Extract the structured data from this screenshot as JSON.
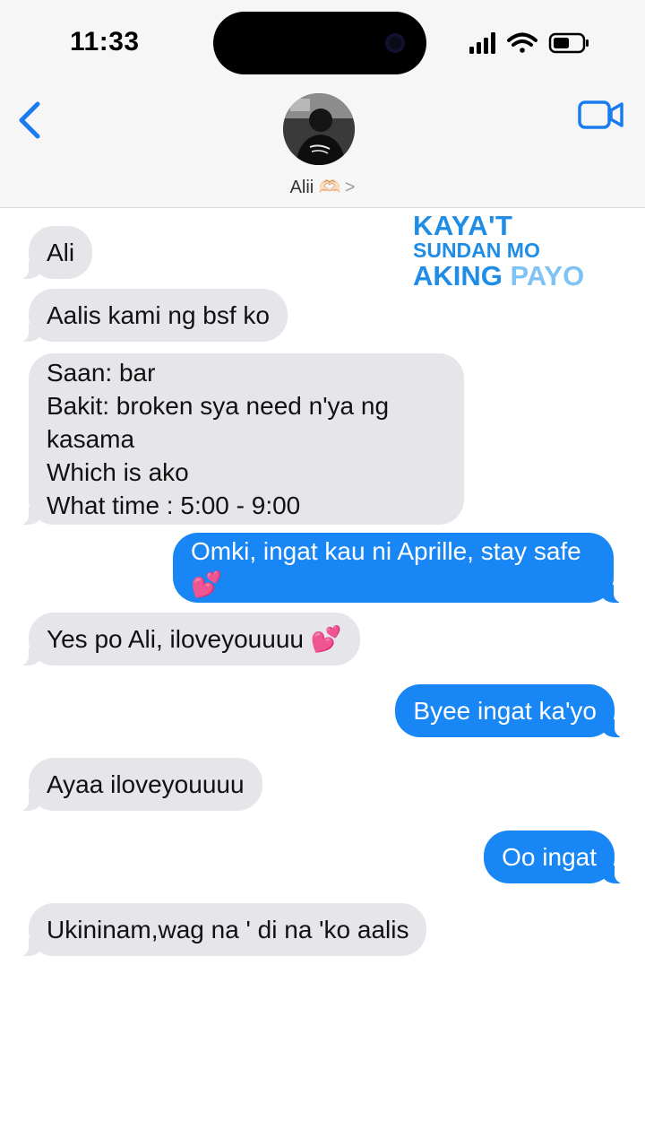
{
  "status_bar": {
    "time": "11:33"
  },
  "contact": {
    "name": "Alii 🫶🏻",
    "chevron": ">"
  },
  "overlay": {
    "line1": "KAYA'T",
    "line2": "SUNDAN MO",
    "line3a": "AKING",
    "line3b": "PAYO"
  },
  "messages": [
    {
      "dir": "in",
      "text": "Ali"
    },
    {
      "dir": "in",
      "text": "Aalis kami ng bsf ko"
    },
    {
      "dir": "in",
      "text": "Saan: bar\nBakit: broken sya need n'ya ng kasama\nWhich is ako\nWhat time : 5:00 - 9:00"
    },
    {
      "dir": "out",
      "text": "Omki, ingat kau ni Aprille, stay safe💕"
    },
    {
      "dir": "in",
      "text": "Yes po Ali, iloveyouuuu 💕"
    },
    {
      "dir": "out",
      "text": "Byee ingat ka'yo"
    },
    {
      "dir": "in",
      "text": "Ayaa iloveyouuuu"
    },
    {
      "dir": "out",
      "text": "Oo ingat"
    },
    {
      "dir": "in",
      "text": "Ukininam,wag na ' di na 'ko aalis"
    }
  ],
  "colors": {
    "accent": "#1887f5",
    "incoming": "#e6e6ea",
    "ios_blue": "#1a7cf0"
  },
  "icons": [
    "back-chevron-icon",
    "video-call-icon",
    "cellular-signal-icon",
    "wifi-icon",
    "battery-icon"
  ]
}
